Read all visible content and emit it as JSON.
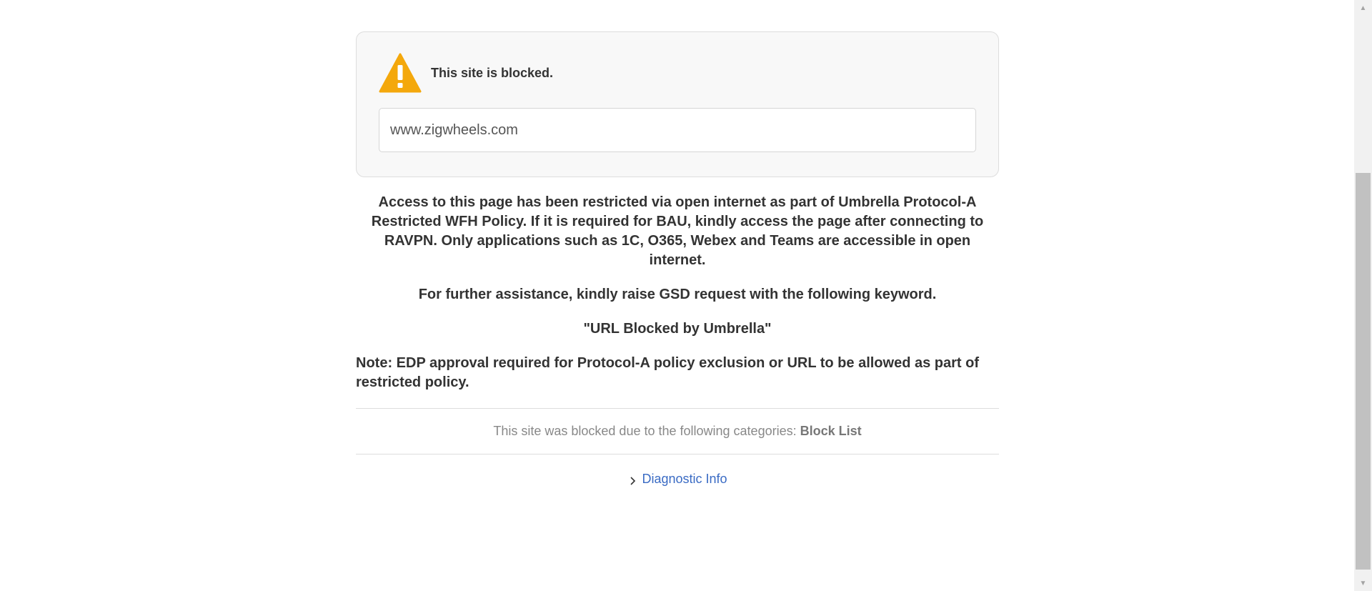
{
  "card": {
    "title": "This site is blocked.",
    "url": "www.zigwheels.com",
    "icon": "warning-icon",
    "icon_color": "#f4a80c"
  },
  "message": {
    "paragraph1": "Access to this page has been restricted via open internet as part of Umbrella Protocol-A Restricted WFH Policy. If it is required for BAU, kindly access the page after connecting to RAVPN. Only applications such as 1C, O365, Webex and Teams are accessible in open internet.",
    "paragraph2": "For further assistance, kindly raise GSD request with the following keyword.",
    "keyword": "\"URL Blocked by Umbrella\"",
    "note": "Note: EDP approval required for Protocol-A policy exclusion or URL to be allowed as part of restricted policy."
  },
  "categories": {
    "prefix": "This site was blocked due to the following categories: ",
    "name": "Block List"
  },
  "diagnostic": {
    "label": "Diagnostic Info",
    "icon": "chevron-right-icon",
    "link_color": "#3a6bc4"
  }
}
